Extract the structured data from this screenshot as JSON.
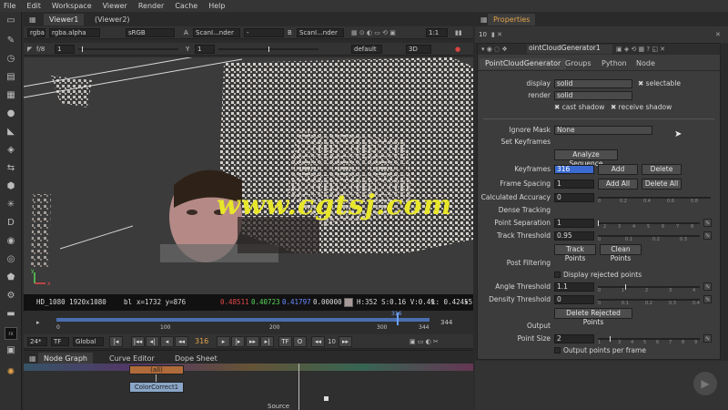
{
  "menu": [
    "File",
    "Edit",
    "Workspace",
    "Viewer",
    "Render",
    "Cache",
    "Help"
  ],
  "viewer": {
    "tabs": [
      "Viewer1",
      "(Viewer2)"
    ],
    "channels": "rgba",
    "layer": "rgba.alpha",
    "colorspace": "sRGB",
    "input_a_label": "A",
    "input_a": "ScanI...nder",
    "input_dash": "-",
    "input_b_label": "B",
    "input_b": "ScanI...nder",
    "zoom": "1:1",
    "fstop": "f/8",
    "gain_value": "1",
    "gain_ticks": [
      "1",
      "0.003",
      "0.125",
      "1",
      "8"
    ],
    "y_label": "Y",
    "gamma_value": "1",
    "gamma_ticks": [
      "0",
      "0.5",
      "1",
      "1.5",
      "2"
    ],
    "lut": "default",
    "view_mode": "3D",
    "info": {
      "format": "HD_1080 1920x1080",
      "bbox": "bl",
      "coords": "x=1732 y=876",
      "r": "0.48511",
      "g": "0.40723",
      "b": "0.41797",
      "a": "0.00000",
      "hsv": "H:352 S:0.16 V:0.49",
      "l": "L: 0.42455"
    },
    "axis_y": "y",
    "axis_x": "x",
    "watermark": "www.cgtsj.com",
    "colors": {
      "r": "#e24848",
      "g": "#5ad65a",
      "b": "#6a8cff"
    }
  },
  "timeline": {
    "start": "0",
    "end": "344",
    "current_marker": "316",
    "ticks": [
      "0",
      "100",
      "200",
      "300",
      "344"
    ],
    "fps": "24*",
    "tf": "TF",
    "range": "Global",
    "frame": "316",
    "step": "10",
    "frame_start": "1",
    "buttons": [
      "|<",
      "<|",
      "|<<",
      "<",
      "<|",
      "316",
      "|>",
      "|>>",
      ">|",
      "T>F",
      "O",
      "<<",
      "10",
      ">>"
    ]
  },
  "nodegraph": {
    "tabs": [
      "Node Graph",
      "Curve Editor",
      "Dope Sheet"
    ],
    "nodes": {
      "top": "(all)",
      "middle": "ColorCorrect1",
      "source": "Source"
    }
  },
  "properties": {
    "title": "Properties",
    "count": "10",
    "node_name": "ointCloudGenerator1",
    "tabs": [
      "PointCloudGenerator",
      "Groups",
      "Python",
      "Node"
    ],
    "display_label": "display",
    "display_value": "solid",
    "selectable_label": "selectable",
    "render_label": "render",
    "render_value": "solid",
    "cast_shadow_label": "cast shadow",
    "receive_shadow_label": "receive shadow",
    "ignore_mask_label": "Ignore Mask",
    "ignore_mask_value": "None",
    "set_keyframes_label": "Set Keyframes",
    "analyze_button": "Analyze Sequence",
    "keyframes_label": "Keyframes",
    "keyframes_value": "316",
    "add_button": "Add",
    "delete_button": "Delete",
    "frame_spacing_label": "Frame Spacing",
    "frame_spacing_value": "1",
    "add_all_button": "Add All",
    "delete_all_button": "Delete All",
    "calc_accuracy_label": "Calculated Accuracy",
    "calc_accuracy_value": "0",
    "calc_ticks": [
      "0",
      "0.2",
      "0.4",
      "0.6",
      "0.8"
    ],
    "tracking_section": "Dense Tracking",
    "point_sep_label": "Point Separation",
    "point_sep_value": "1",
    "point_sep_ticks": [
      "1",
      "2",
      "3",
      "4",
      "5",
      "6",
      "7",
      "8"
    ],
    "track_threshold_label": "Track Threshold",
    "track_threshold_value": "0.95",
    "track_threshold_ticks": [
      "0",
      "0.1",
      "0.2",
      "0.3"
    ],
    "track_points_button": "Track Points",
    "clean_points_button": "Clean Points",
    "post_filtering_section": "Post Filtering",
    "display_rejected_label": "Display rejected points",
    "angle_threshold_label": "Angle Threshold",
    "angle_threshold_value": "1.1",
    "angle_ticks": [
      "0",
      "1",
      "2",
      "3",
      "4"
    ],
    "density_threshold_label": "Density Threshold",
    "density_threshold_value": "0",
    "density_ticks": [
      "0",
      "0.1",
      "0.2",
      "0.3",
      "0.4"
    ],
    "delete_rejected_button": "Delete Rejected Points",
    "output_section": "Output",
    "point_size_label": "Point Size",
    "point_size_value": "2",
    "point_size_ticks": [
      "1",
      "2",
      "3",
      "4",
      "5",
      "6",
      "7",
      "8",
      "9"
    ],
    "output_per_frame_label": "Output points per frame"
  }
}
